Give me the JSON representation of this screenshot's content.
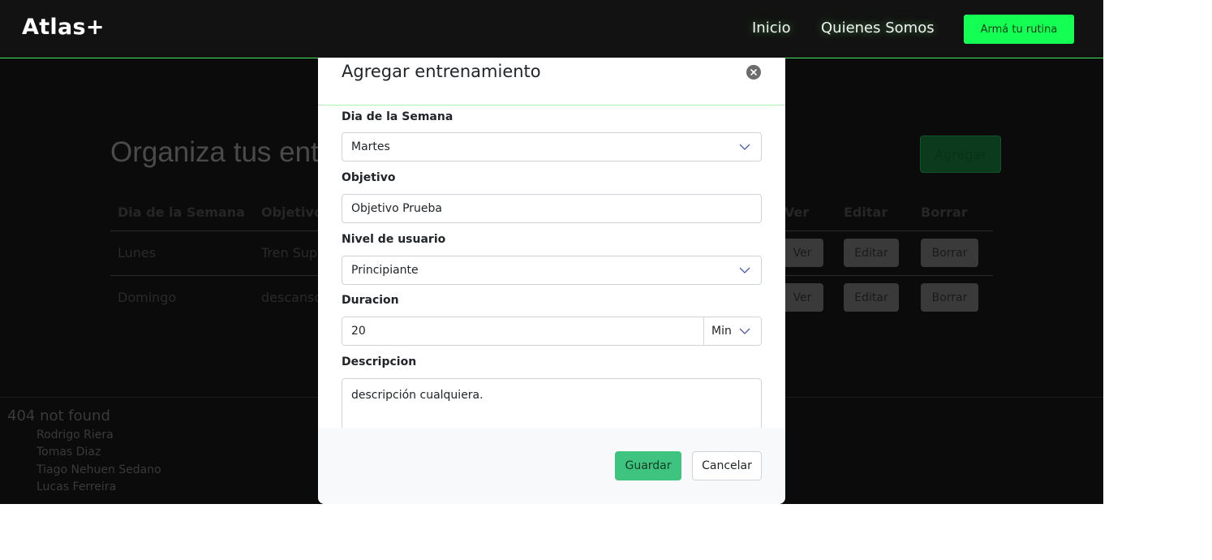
{
  "navbar": {
    "brand": "Atlas+",
    "links": [
      "Inicio",
      "Quienes Somos"
    ],
    "cta_label": "Armá tu rutina"
  },
  "page": {
    "title": "Organiza tus entrenamientos",
    "add_button": "Agregar"
  },
  "table": {
    "headers": [
      "Dia de la Semana",
      "Objetivo",
      "Ver",
      "Editar",
      "Borrar"
    ],
    "rows": [
      {
        "dia": "Lunes",
        "objetivo": "Tren Superior",
        "ver": "Ver",
        "editar": "Editar",
        "borrar": "Borrar"
      },
      {
        "dia": "Domingo",
        "objetivo": "descanso",
        "ver": "Ver",
        "editar": "Editar",
        "borrar": "Borrar"
      }
    ]
  },
  "footer": {
    "title": "404 not found",
    "names": [
      "Rodrigo Riera",
      "Tomas Diaz",
      "Tiago Nehuen Sedano",
      "Lucas Ferreira"
    ]
  },
  "modal": {
    "title": "Agregar entrenamiento",
    "fields": {
      "dia": {
        "label": "Dia de la Semana",
        "value": "Martes"
      },
      "objetivo": {
        "label": "Objetivo",
        "value": "Objetivo Prueba"
      },
      "nivel": {
        "label": "Nivel de usuario",
        "value": "Principiante"
      },
      "duracion": {
        "label": "Duracion",
        "value": "20",
        "unit": "Min"
      },
      "descripcion": {
        "label": "Descripcion",
        "value": "descripción cualquiera."
      }
    },
    "save_label": "Guardar",
    "cancel_label": "Cancelar"
  },
  "colors": {
    "accent": "#13ff53",
    "save_button": "#3fc47f",
    "navbar_border": "#3ee65c"
  }
}
